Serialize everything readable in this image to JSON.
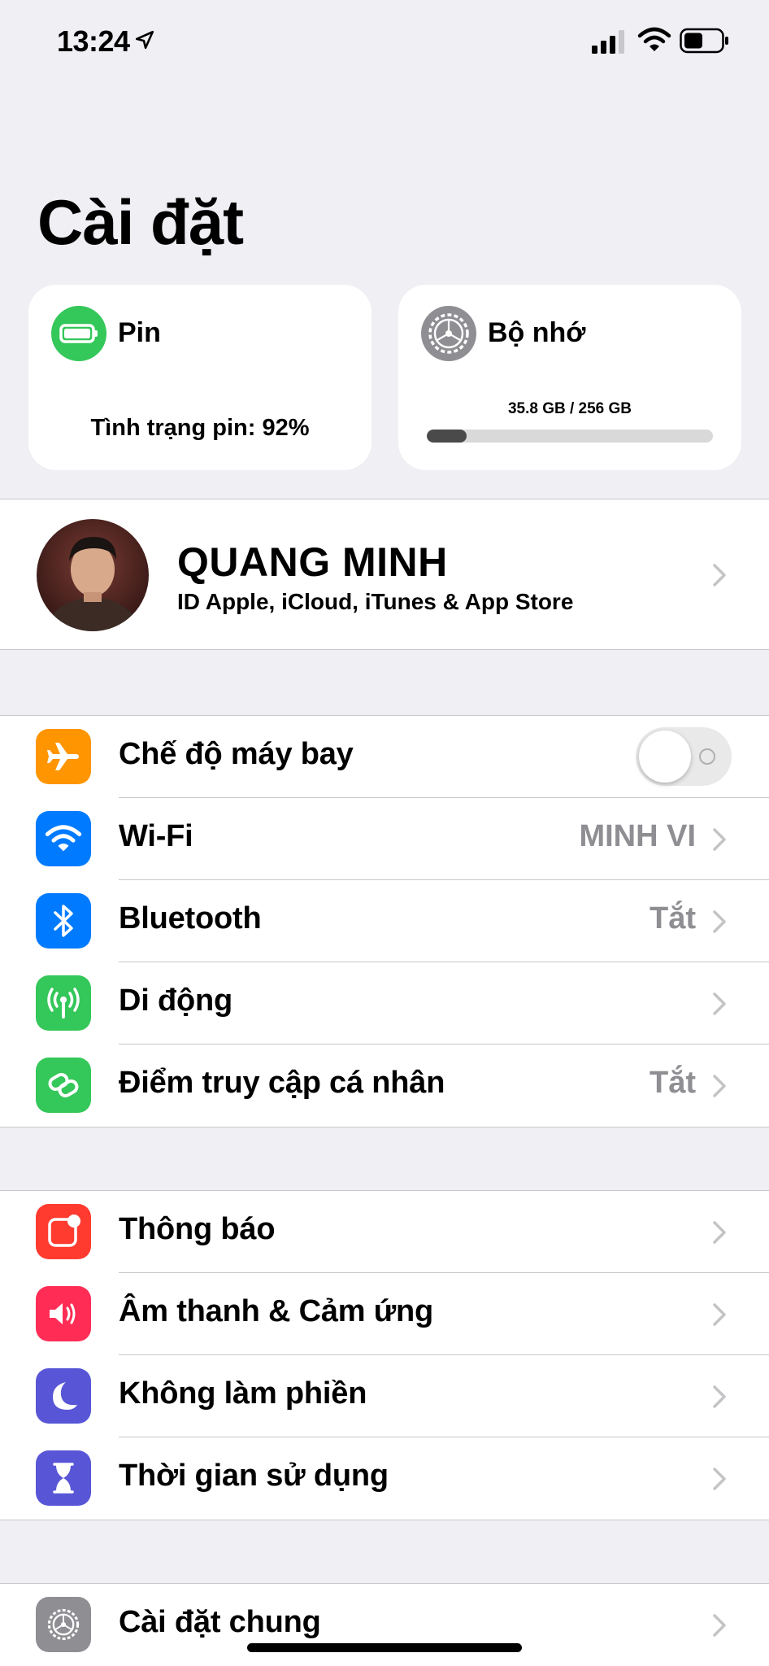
{
  "status_bar": {
    "time": "13:24",
    "icons": [
      "location-arrow-icon",
      "cellular-signal-icon",
      "wifi-icon",
      "battery-icon"
    ]
  },
  "title": "Cài đặt",
  "widgets": {
    "battery": {
      "title": "Pin",
      "status": "Tình trạng pin: 92%",
      "icon": "battery-icon",
      "color": "#34c759"
    },
    "storage": {
      "title": "Bộ nhớ",
      "usage": "35.8 GB / 256 GB",
      "used_fraction": 0.14,
      "icon": "gear-icon",
      "color": "#8e8e93"
    }
  },
  "profile": {
    "name": "QUANG MINH",
    "subtitle": "ID Apple, iCloud, iTunes & App Store"
  },
  "group1": [
    {
      "key": "airplane",
      "label": "Chế độ máy bay",
      "icon": "airplane-icon",
      "color": "#ff9500",
      "toggle": false
    },
    {
      "key": "wifi",
      "label": "Wi-Fi",
      "value": "MINH VI",
      "icon": "wifi-icon",
      "color": "#007aff"
    },
    {
      "key": "bluetooth",
      "label": "Bluetooth",
      "value": "Tắt",
      "icon": "bluetooth-icon",
      "color": "#007aff"
    },
    {
      "key": "cellular",
      "label": "Di động",
      "value": "",
      "icon": "antenna-icon",
      "color": "#34c759"
    },
    {
      "key": "hotspot",
      "label": "Điểm truy cập cá nhân",
      "value": "Tắt",
      "icon": "hotspot-chain-icon",
      "color": "#34c759"
    }
  ],
  "group2": [
    {
      "key": "notifications",
      "label": "Thông báo",
      "icon": "notifications-icon",
      "color": "#ff3b30"
    },
    {
      "key": "sounds",
      "label": "Âm thanh & Cảm ứng",
      "icon": "speaker-icon",
      "color": "#ff2d55"
    },
    {
      "key": "dnd",
      "label": "Không làm phiền",
      "icon": "moon-icon",
      "color": "#5856d6"
    },
    {
      "key": "screentime",
      "label": "Thời gian sử dụng",
      "icon": "hourglass-icon",
      "color": "#5856d6"
    }
  ],
  "group3": [
    {
      "key": "general",
      "label": "Cài đặt chung",
      "icon": "gear-icon",
      "color": "#8e8e93"
    }
  ]
}
